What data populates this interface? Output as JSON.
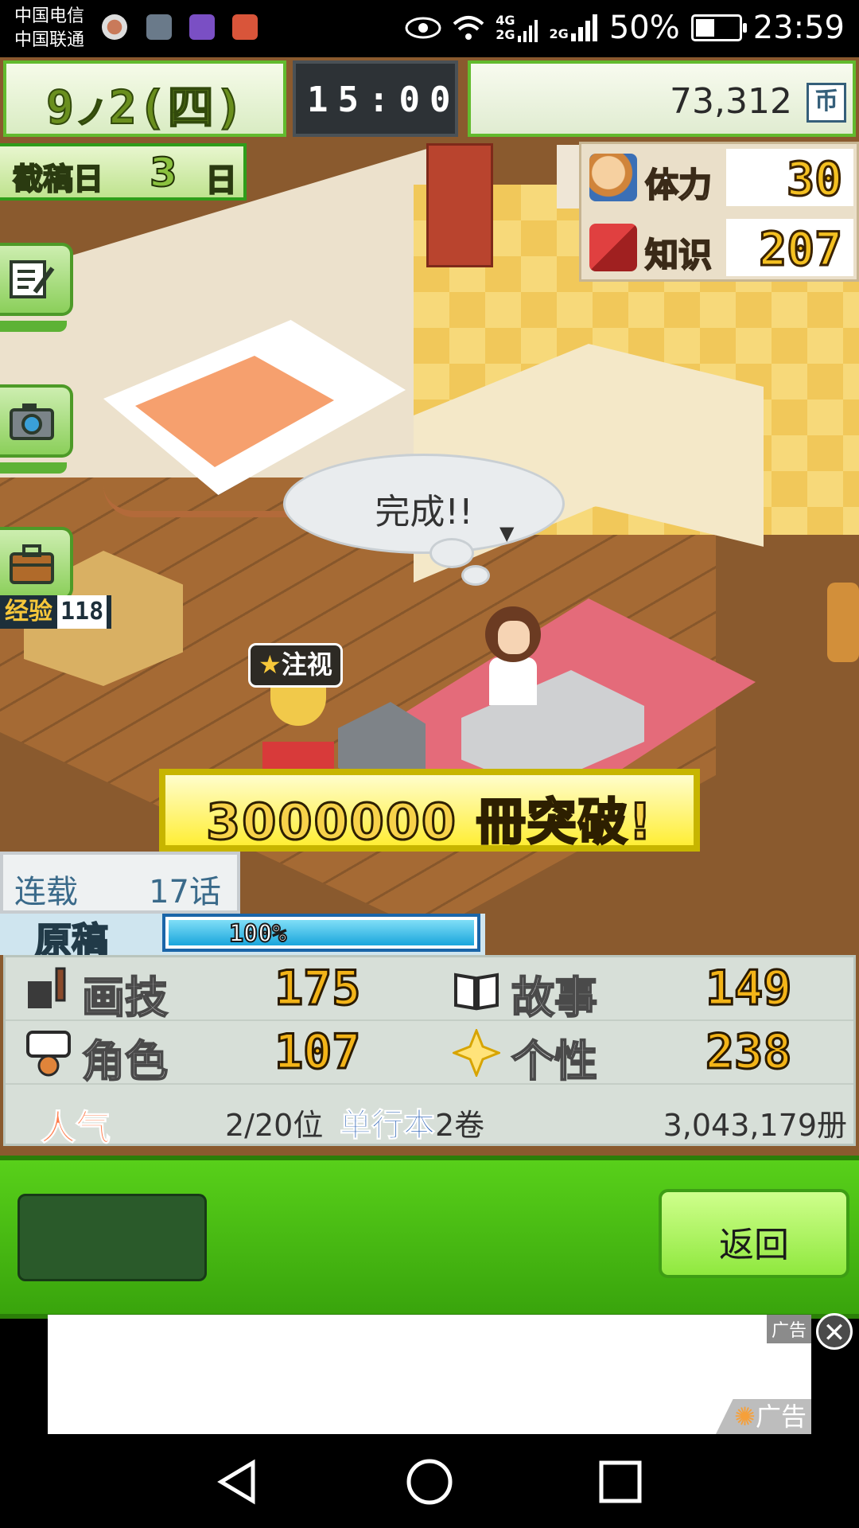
{
  "status_bar": {
    "carrier_1": "中国电信",
    "carrier_2": "中国联通",
    "network_1": "4G",
    "network_1b": "2G",
    "network_2": "2G",
    "battery_percent": "50%",
    "battery_level": 0.5,
    "time": "23:59",
    "notification_icons": [
      "contact-icon",
      "gallery-icon",
      "keyboard-icon",
      "app-icon"
    ],
    "colors": {
      "keyboard": "#7a4fc4",
      "app": "#d9553a",
      "gallery": "#6a7a8a"
    }
  },
  "hud": {
    "date_month": "9",
    "date_sep": "ノ",
    "date_day": "2",
    "date_weekday": "(四)",
    "time": "15:00",
    "money": "73,312",
    "money_icon_label": "币",
    "deadline_label": "截稿日",
    "deadline_days": "3",
    "deadline_unit": "日"
  },
  "stats": {
    "stamina_label": "体力",
    "stamina_value": "30",
    "knowledge_label": "知识",
    "knowledge_value": "207"
  },
  "side_menu": {
    "items": [
      "edit-icon",
      "camera-icon",
      "briefcase-icon"
    ],
    "exp_label": "经验",
    "exp_value": "118"
  },
  "scene": {
    "bubble_text": "完成!!",
    "attention_label": "注视",
    "milestone_text": "3000000 冊突破!"
  },
  "work_info": {
    "serial_label": "连载",
    "serial_value": "17话",
    "manuscript_label": "原稿",
    "progress_text": "100%",
    "progress_value": 1.0,
    "drawing_label": "画技",
    "drawing_value": "175",
    "story_label": "故事",
    "story_value": "149",
    "character_label": "角色",
    "character_value": "107",
    "personality_label": "个性",
    "personality_value": "238",
    "popularity_label": "人气",
    "popularity_value": "2/20位",
    "volume_label": "单行本",
    "volume_value": "2卷",
    "sales_value": "3,043,179册"
  },
  "bottom": {
    "back_label": "返回"
  },
  "ad": {
    "tag": "广告",
    "corner_label": "广告",
    "close_glyph": "✕"
  }
}
